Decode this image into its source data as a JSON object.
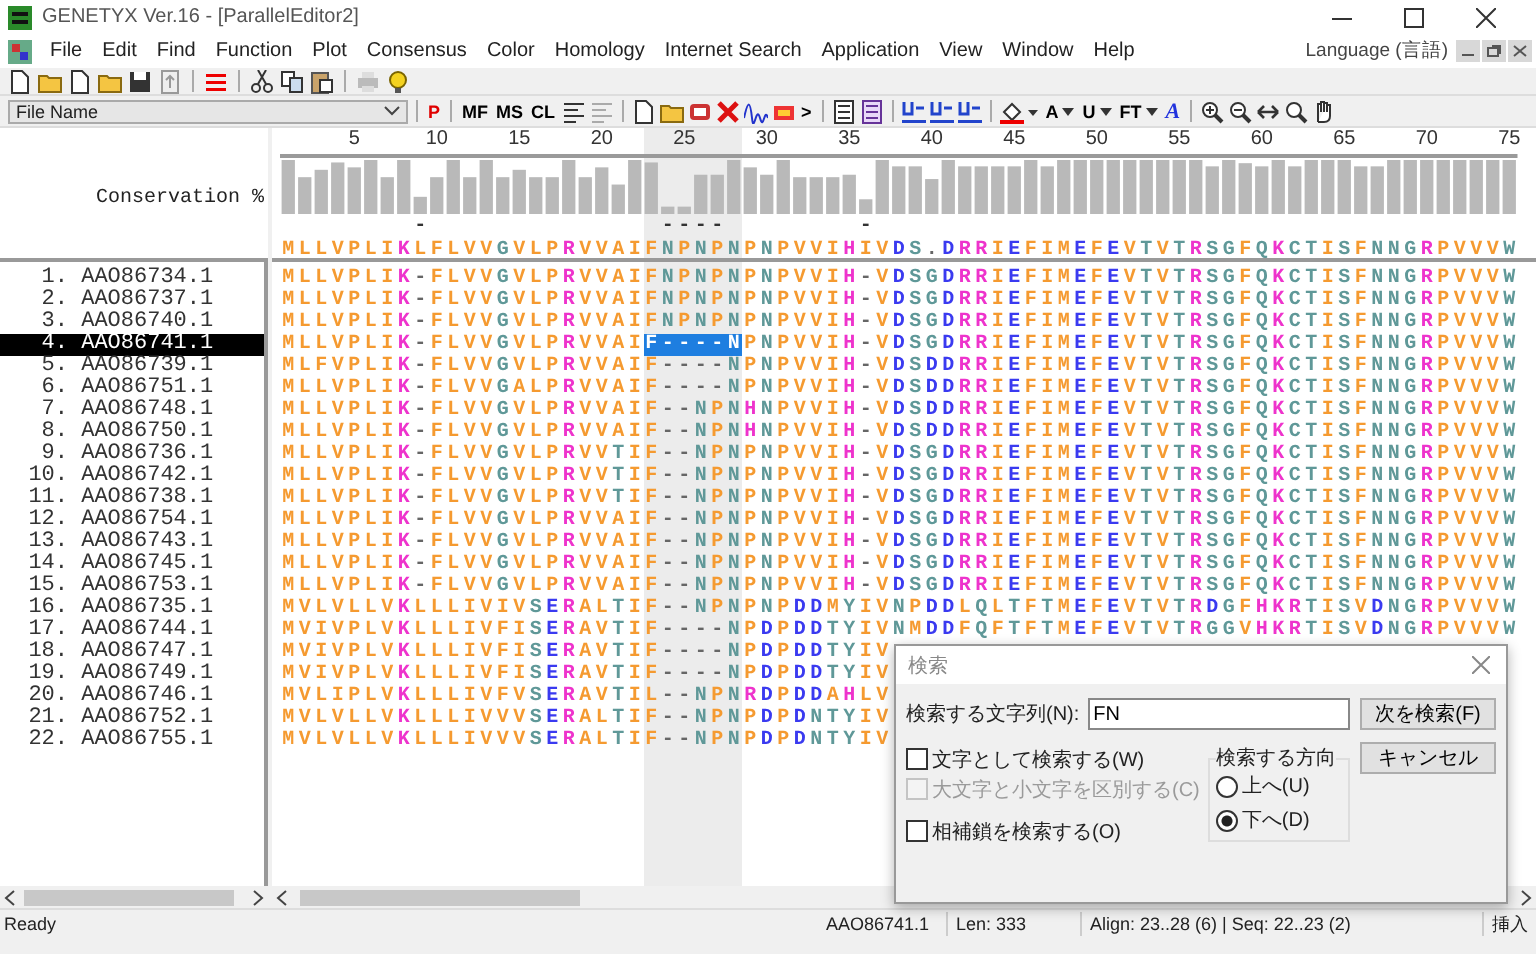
{
  "window": {
    "title": "GENETYX Ver.16 - [ParallelEditor2]"
  },
  "menu": {
    "items": [
      "File",
      "Edit",
      "Find",
      "Function",
      "Plot",
      "Consensus",
      "Color",
      "Homology",
      "Internet Search",
      "Application",
      "View",
      "Window",
      "Help"
    ],
    "language": "Language (言語)"
  },
  "toolbar_1": [
    {
      "kind": "new"
    },
    {
      "kind": "open"
    },
    {
      "kind": "new"
    },
    {
      "kind": "open"
    },
    {
      "kind": "save"
    },
    {
      "kind": "export"
    },
    {
      "kind": "separator"
    },
    {
      "kind": "lines"
    },
    {
      "kind": "separator"
    },
    {
      "kind": "cut"
    },
    {
      "kind": "copy"
    },
    {
      "kind": "paste"
    },
    {
      "kind": "separator"
    },
    {
      "kind": "print"
    },
    {
      "kind": "help"
    }
  ],
  "toolbar_2": {
    "dropdown": "File Name",
    "items": [
      {
        "kind": "separator"
      },
      {
        "kind": "glyph",
        "label": "P",
        "color": "#e00000"
      },
      {
        "kind": "separator"
      },
      {
        "kind": "glyph",
        "label": "MF",
        "color": "#000000"
      },
      {
        "kind": "glyph",
        "label": "MS",
        "color": "#000000"
      },
      {
        "kind": "glyph",
        "label": "CL",
        "color": "#000000"
      },
      {
        "kind": "align"
      },
      {
        "kind": "align-gray"
      },
      {
        "kind": "separator"
      },
      {
        "kind": "new"
      },
      {
        "kind": "open"
      },
      {
        "kind": "db"
      },
      {
        "kind": "delete"
      },
      {
        "kind": "wave"
      },
      {
        "kind": "tag"
      },
      {
        "kind": "glyph",
        "label": ">",
        "color": "#000000"
      },
      {
        "kind": "separator"
      },
      {
        "kind": "panel"
      },
      {
        "kind": "panel-color"
      },
      {
        "kind": "separator"
      },
      {
        "kind": "style"
      },
      {
        "kind": "style"
      },
      {
        "kind": "style"
      },
      {
        "kind": "separator"
      },
      {
        "kind": "fill"
      },
      {
        "kind": "glyph-dropdown",
        "label": "A",
        "color": "#000000"
      },
      {
        "kind": "glyph-dropdown",
        "label": "U",
        "color": "#000000"
      },
      {
        "kind": "glyph-dropdown",
        "label": "FT",
        "color": "#000000"
      },
      {
        "kind": "glyph",
        "label": "A",
        "color": "#2233dd"
      },
      {
        "kind": "separator"
      },
      {
        "kind": "zoom-in"
      },
      {
        "kind": "zoom-out"
      },
      {
        "kind": "fit"
      },
      {
        "kind": "zoom"
      },
      {
        "kind": "hand"
      }
    ]
  },
  "alignment": {
    "ruler": [
      "5",
      "10",
      "15",
      "20",
      "25",
      "30",
      "35",
      "40",
      "45",
      "50",
      "55",
      "60",
      "65",
      "70",
      "75"
    ],
    "conservation_label": "Conservation %",
    "consensus": "MLLVPLIKLFLVVGVLPRVVAIFNPNPNPNPVVIHIVDS.DRRIEFIMEFEVTVTRSGFQKCTISFNNGRPVVVW",
    "gap_marks": [
      "-",
      "-",
      "-",
      "-",
      "-",
      "-"
    ],
    "column_highlighted": [
      false,
      false,
      false,
      false,
      false,
      false,
      false,
      false,
      false,
      false,
      false,
      false,
      false,
      false,
      false,
      false,
      false,
      false,
      false,
      false,
      false,
      false,
      true,
      true,
      true,
      true,
      true,
      true,
      false,
      false,
      false,
      false,
      false,
      false,
      false,
      false,
      false,
      false,
      false,
      false,
      false,
      false,
      false,
      false,
      false,
      false,
      false,
      false,
      false,
      false,
      false,
      false,
      false,
      false,
      false,
      false,
      false,
      false,
      false,
      false,
      false,
      false,
      false,
      false,
      false,
      false,
      false,
      false,
      false,
      false,
      false,
      false,
      false,
      false,
      false
    ],
    "sequences": [
      {
        "index": "1.",
        "name": "AAO86734.1",
        "selected": false,
        "residues": "MLLVPLIK-FLVVGVLPRVVAIFNPNPNPNPVVIH-VDSGDRRIEFIMEFEVTVTRSGFQKCTISFNNGRPVVVW"
      },
      {
        "index": "2.",
        "name": "AAO86737.1",
        "selected": false,
        "residues": "MLLVPLIK-FLVVGVLPRVVAIFNPNPNPNPVVIH-VDSGDRRIEFIMEFEVTVTRSGFQKCTISFNNGRPVVVW"
      },
      {
        "index": "3.",
        "name": "AAO86740.1",
        "selected": false,
        "residues": "MLLVPLIK-FLVVGVLPRVVAIFNPNPNPNPVVIH-VDSGDRRIEFIMEFEVTVTRSGFQKCTISFNNGRPVVVW"
      },
      {
        "index": "4.",
        "name": "AAO86741.1",
        "selected": true,
        "residues": "MLLVPLIK-FLVVGVLPRVVAIF----NPNPVVIH-VDSGDRRIEFIMEFEVTVTRSGFQKCTISFNNGRPVVVW"
      },
      {
        "index": "5.",
        "name": "AAO86739.1",
        "selected": false,
        "residues": "MLFVPLIK-FLVVGVLPRVVAIF----NPNPVVIH-VDSDDRRIEFIMEFEVTVTRSGFQKCTISFNNGRPVVVW"
      },
      {
        "index": "6.",
        "name": "AAO86751.1",
        "selected": false,
        "residues": "MLLVPLIK-FLVVGALPRVVAIF----NPNPVVIH-VDSDDRRIEFIMEFEVTVTRSGFQKCTISFNNGRPVVVW"
      },
      {
        "index": "7.",
        "name": "AAO86748.1",
        "selected": false,
        "residues": "MLLVPLIK-FLVVGVLPRVVAIF--NPNHNPVVIH-VDSDDRRIEFIMEFEVTVTRSGFQKCTISFNNGRPVVVW"
      },
      {
        "index": "8.",
        "name": "AAO86750.1",
        "selected": false,
        "residues": "MLLVPLIK-FLVVGVLPRVVAIF--NPNHNPVVIH-VDSDDRRIEFIMEFEVTVTRSGFQKCTISFNNGRPVVVW"
      },
      {
        "index": "9.",
        "name": "AAO86736.1",
        "selected": false,
        "residues": "MLLVPLIK-FLVVGVLPRVVTIF--NPNPNPVVIH-VDSGDRRIEFIMEFEVTVTRSGFQKCTISFNNGRPVVVW"
      },
      {
        "index": "10.",
        "name": "AAO86742.1",
        "selected": false,
        "residues": "MLLVPLIK-FLVVGVLPRVVTIF--NPNPNPVVIH-VDSGDRRIEFIMEFEVTVTRSGFQKCTISFNNGRPVVVW"
      },
      {
        "index": "11.",
        "name": "AAO86738.1",
        "selected": false,
        "residues": "MLLVPLIK-FLVVGVLPRVVTIF--NPNPNPVVIH-VDSGDRRIEFIMEFEVTVTRSGFQKCTISFNNGRPVVVW"
      },
      {
        "index": "12.",
        "name": "AAO86754.1",
        "selected": false,
        "residues": "MLLVPLIK-FLVVGVLPRVVAIF--NPNPNPVVIH-VDSGDRRIEFIMEFEVTVTRSGFQKCTISFNNGRPVVVW"
      },
      {
        "index": "13.",
        "name": "AAO86743.1",
        "selected": false,
        "residues": "MLLVPLIK-FLVVGVLPRVVAIF--NPNPNPVVIH-VDSGDRRIEFIMEFEVTVTRSGFQKCTISFNNGRPVVVW"
      },
      {
        "index": "14.",
        "name": "AAO86745.1",
        "selected": false,
        "residues": "MLLVPLIK-FLVVGVLPRVVAIF--NPNPNPVVIH-VDSGDRRIEFIMEFEVTVTRSGFQKCTISFNNGRPVVVW"
      },
      {
        "index": "15.",
        "name": "AAO86753.1",
        "selected": false,
        "residues": "MLLVPLIK-FLVVGVLPRVVAIF--NPNPNPVVIH-VDSGDRRIEFIMEFEVTVTRSGFQKCTISFNNGRPVVVW"
      },
      {
        "index": "16.",
        "name": "AAO86735.1",
        "selected": false,
        "residues": "MVLVLLVKLLLIVIVSERALTIF--NPNPNPDDMYIVNPDDLQLTFTMEFEVTVTRDGFHKRTISVDNGRPVVVW"
      },
      {
        "index": "17.",
        "name": "AAO86744.1",
        "selected": false,
        "residues": "MVIVPLVKLLLIVFISERAVTIF----NPDPDDTYIVNMDDFQFTFTMEFEVTVTRGGVHKRTISVDNGRPVVVW"
      },
      {
        "index": "18.",
        "name": "AAO86747.1",
        "selected": false,
        "residues": "MVIVPLVKLLLIVFISERAVTIF----NPDPDDTYIV"
      },
      {
        "index": "19.",
        "name": "AAO86749.1",
        "selected": false,
        "residues": "MVIVPLVKLLLIVFISERAVTIF----NPDPDDTYIV"
      },
      {
        "index": "20.",
        "name": "AAO86746.1",
        "selected": false,
        "residues": "MVLIPLVKLLLIVFVSERAVTIL--NPNRDPDDAHLV"
      },
      {
        "index": "21.",
        "name": "AAO86752.1",
        "selected": false,
        "residues": "MVLVLLVKLLLIVVVSERALTIF--NPNPDPDNTYIV"
      },
      {
        "index": "22.",
        "name": "AAO86755.1",
        "selected": false,
        "residues": "MVLVLLVKLLLIVVVSERALTIF--NPNPDPDNTYIV"
      }
    ]
  },
  "status_bar": {
    "message": "Ready",
    "sequence": "AAO86741.1",
    "length": "Len: 333",
    "position": "Align: 23..28 (6) | Seq: 22..23 (2)",
    "mode": "挿入"
  },
  "dialog": {
    "title": "検索",
    "search_label": "検索する文字列(N):",
    "search_value": "FN",
    "find_next": "次を検索(F)",
    "cancel": "キャンセル",
    "options": [
      {
        "label": "文字として検索する(W)",
        "checked": false,
        "disabled": false
      },
      {
        "label": "大文字と小文字を区別する(C)",
        "checked": false,
        "disabled": true
      },
      {
        "label": "相補鎖を検索する(O)",
        "checked": false,
        "disabled": false
      }
    ],
    "direction": {
      "label": "検索する方向",
      "choices": [
        {
          "label": "上へ(U)",
          "selected": false
        },
        {
          "label": "下へ(D)",
          "selected": true
        }
      ]
    }
  }
}
